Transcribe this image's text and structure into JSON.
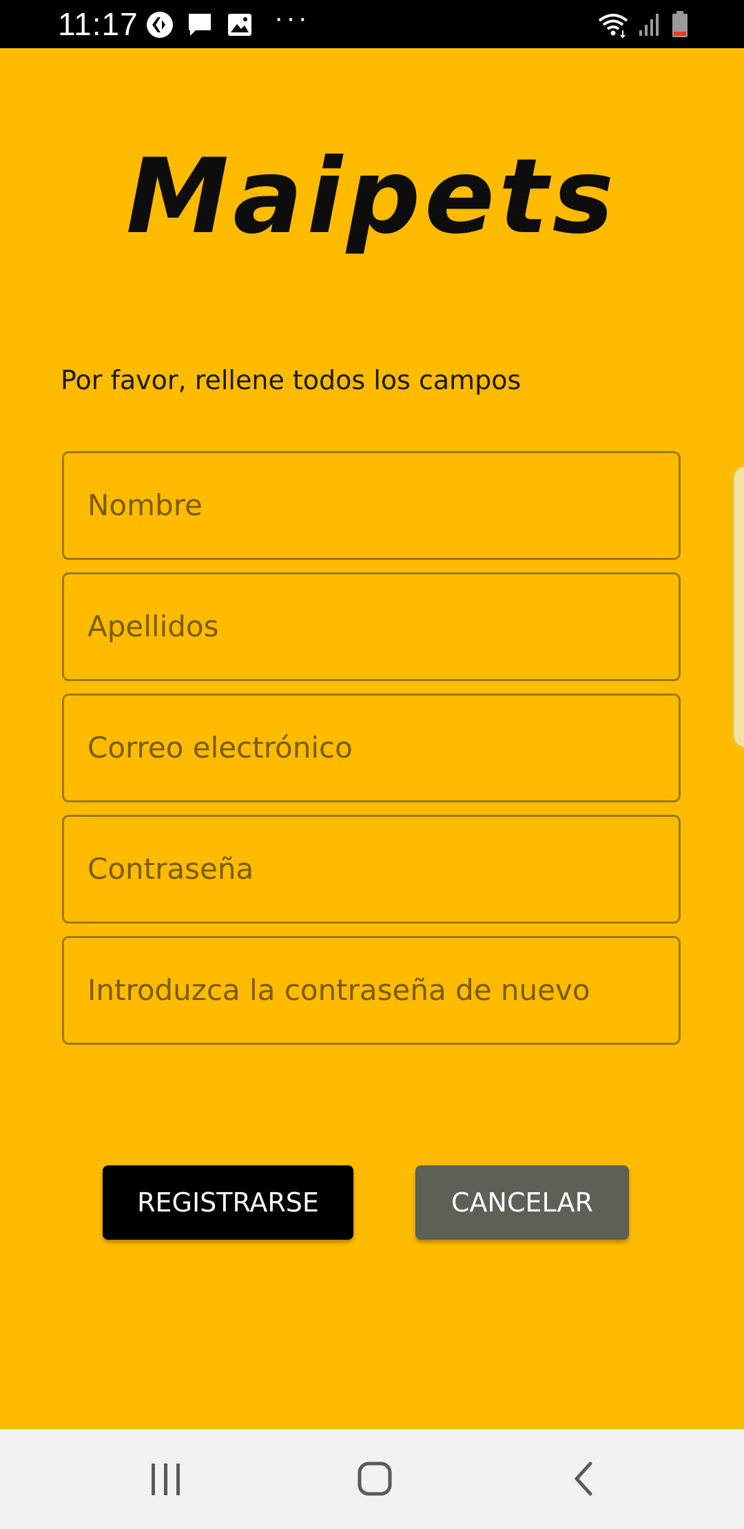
{
  "status_bar": {
    "time": "11:17",
    "dots": "···",
    "icons": [
      "carrefour-app-icon",
      "message-icon",
      "image-icon",
      "wifi-icon",
      "signal-icon",
      "battery-icon"
    ]
  },
  "app": {
    "logo_text": "Maipets",
    "instructions": "Por favor, rellene todos los campos"
  },
  "form": {
    "fields": [
      {
        "placeholder": "Nombre"
      },
      {
        "placeholder": "Apellidos"
      },
      {
        "placeholder": "Correo electrónico"
      },
      {
        "placeholder": "Contraseña"
      },
      {
        "placeholder": "Introduzca la contraseña de nuevo"
      }
    ]
  },
  "buttons": {
    "register": "REGISTRARSE",
    "cancel": "CANCELAR"
  },
  "nav_bar": {
    "icons": [
      "recent-apps-icon",
      "home-icon",
      "back-icon"
    ]
  },
  "colors": {
    "background": "#ffbb00",
    "status_bar": "#000000",
    "register_button": "#000000",
    "cancel_button": "#5c6055",
    "nav_bar": "#f2f2f2"
  }
}
